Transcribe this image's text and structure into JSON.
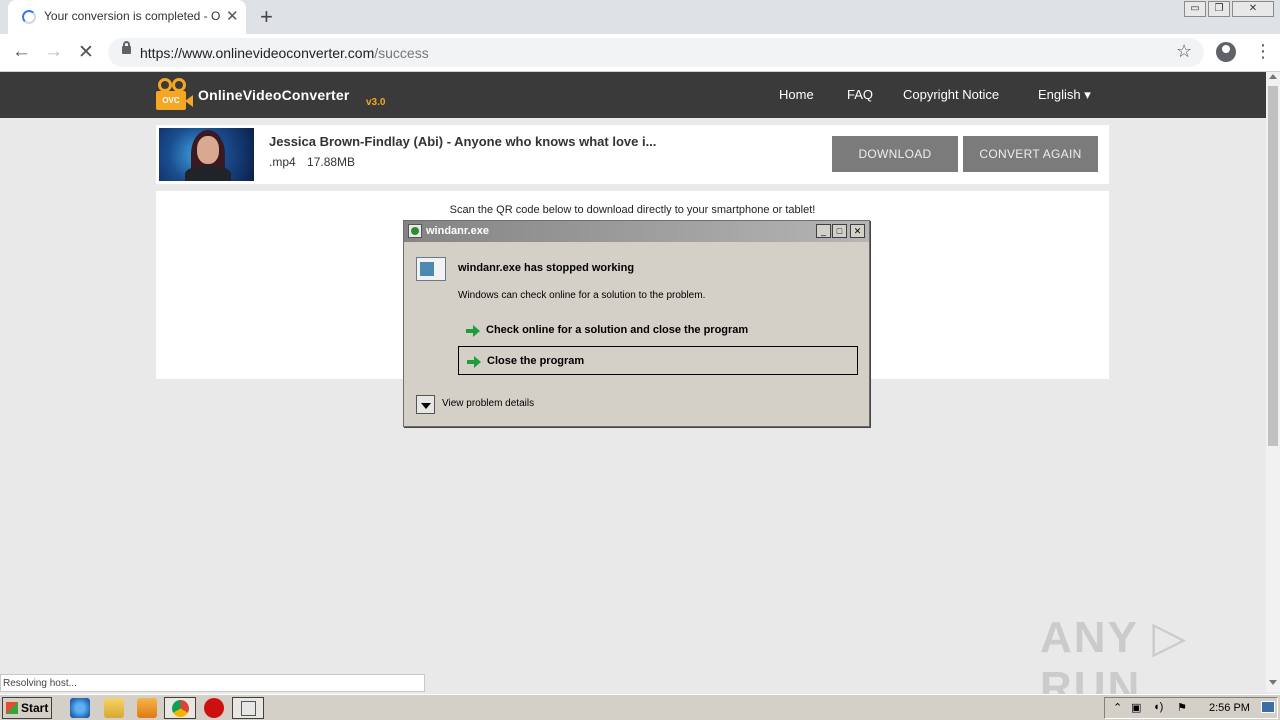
{
  "browser": {
    "tab_title": "Your conversion is completed - Onlin",
    "tab_close": "✕",
    "new_tab": "+",
    "url_host": "https://www.onlinevideoconverter.com",
    "url_path": "/success",
    "back": "←",
    "forward": "→",
    "stop": "✕",
    "star": "☆",
    "menu": "⋮",
    "window_controls": [
      "▭",
      "❐",
      "✕"
    ],
    "status_text": "Resolving host..."
  },
  "site": {
    "logo_badge": "OVC",
    "logo_text": "OnlineVideoConverter",
    "logo_version": "v3.0",
    "nav": [
      "Home",
      "FAQ",
      "Copyright Notice",
      "English ▾"
    ]
  },
  "result": {
    "title": "Jessica Brown-Findlay (Abi) - Anyone who knows what love i...",
    "format": ".mp4",
    "size": "17.88MB",
    "download_label": "DOWNLOAD",
    "convert_again_label": "CONVERT AGAIN"
  },
  "qr": {
    "caption": "Scan the QR code below to download directly to your smartphone or tablet!"
  },
  "dialog": {
    "title": "windanr.exe",
    "heading": "windanr.exe has stopped working",
    "description": "Windows can check online for a solution to the problem.",
    "option_check": "Check online for a solution and close the program",
    "option_close": "Close the program",
    "details": "View problem details",
    "title_buttons": [
      "_",
      "□",
      "✕"
    ]
  },
  "taskbar": {
    "start_label": "Start",
    "clock": "2:56 PM"
  },
  "watermark": "ANY ▷ RUN",
  "colors": {
    "site_header": "#3a3a3a",
    "logo_accent": "#f5a623",
    "button_gray": "#7b7b7b",
    "dialog_bg": "#d4d0c8"
  }
}
